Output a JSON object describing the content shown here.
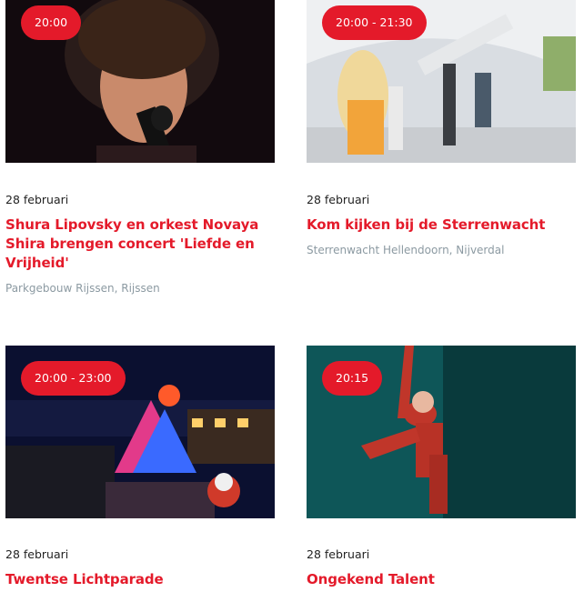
{
  "events": [
    {
      "time": "20:00",
      "date": "28 februari",
      "title": "Shura Lipovsky en orkest Novaya Shira brengen concert 'Liefde en Vrijheid'",
      "location": "Parkgebouw Rijssen, Rijssen"
    },
    {
      "time": "20:00 - 21:30",
      "date": "28 februari",
      "title": "Kom kijken bij de Sterrenwacht",
      "location": "Sterrenwacht Hellendoorn, Nijverdal"
    },
    {
      "time": "20:00 - 23:00",
      "date": "28 februari",
      "title": "Twentse Lichtparade",
      "location": ""
    },
    {
      "time": "20:15",
      "date": "28 februari",
      "title": "Ongekend Talent",
      "location": ""
    }
  ],
  "colors": {
    "accent": "#e41a2a",
    "location_text": "#8c9aa2"
  }
}
